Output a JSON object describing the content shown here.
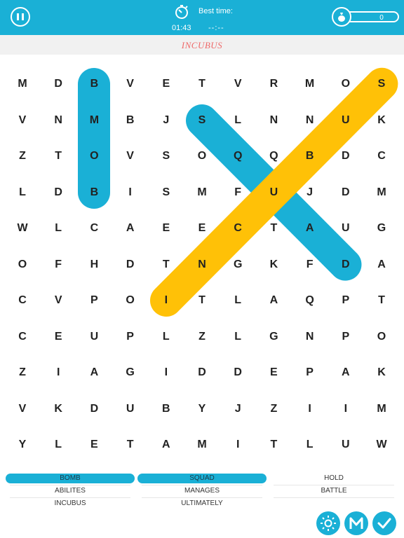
{
  "header": {
    "best_time_label": "Best time:",
    "elapsed": "01:43",
    "best_time": "--:--",
    "coins": "0"
  },
  "current_word": "INCUBUS",
  "grid": [
    [
      "M",
      "D",
      "B",
      "V",
      "E",
      "T",
      "V",
      "R",
      "M",
      "O",
      "S"
    ],
    [
      "V",
      "N",
      "M",
      "B",
      "J",
      "S",
      "L",
      "N",
      "N",
      "U",
      "K"
    ],
    [
      "Z",
      "T",
      "O",
      "V",
      "S",
      "O",
      "Q",
      "Q",
      "B",
      "D",
      "C"
    ],
    [
      "L",
      "D",
      "B",
      "I",
      "S",
      "M",
      "F",
      "U",
      "J",
      "D",
      "M"
    ],
    [
      "W",
      "L",
      "C",
      "A",
      "E",
      "E",
      "C",
      "T",
      "A",
      "U",
      "G"
    ],
    [
      "O",
      "F",
      "H",
      "D",
      "T",
      "N",
      "G",
      "K",
      "F",
      "D",
      "A"
    ],
    [
      "C",
      "V",
      "P",
      "O",
      "I",
      "T",
      "L",
      "A",
      "Q",
      "P",
      "T"
    ],
    [
      "C",
      "E",
      "U",
      "P",
      "L",
      "Z",
      "L",
      "G",
      "N",
      "P",
      "O"
    ],
    [
      "Z",
      "I",
      "A",
      "G",
      "I",
      "D",
      "D",
      "E",
      "P",
      "A",
      "K"
    ],
    [
      "V",
      "K",
      "D",
      "U",
      "B",
      "Y",
      "J",
      "Z",
      "I",
      "I",
      "M"
    ],
    [
      "Y",
      "L",
      "E",
      "T",
      "A",
      "M",
      "I",
      "T",
      "L",
      "U",
      "W"
    ]
  ],
  "highlights": [
    {
      "word": "BOMB",
      "color": "#1ab0d6",
      "from": [
        0,
        2
      ],
      "to": [
        3,
        2
      ]
    },
    {
      "word": "SQUAD",
      "color": "#1ab0d6",
      "from": [
        1,
        5
      ],
      "to": [
        5,
        9
      ]
    },
    {
      "word": "INCUBUS",
      "color": "#ffc107",
      "from": [
        6,
        4
      ],
      "to": [
        0,
        10
      ]
    }
  ],
  "words": [
    {
      "label": "BOMB",
      "found": true
    },
    {
      "label": "SQUAD",
      "found": true
    },
    {
      "label": "HOLD",
      "found": false
    },
    {
      "label": "ABILITES",
      "found": false
    },
    {
      "label": "MANAGES",
      "found": false
    },
    {
      "label": "BATTLE",
      "found": false
    },
    {
      "label": "INCUBUS",
      "found": false
    },
    {
      "label": "ULTIMATELY",
      "found": false
    }
  ],
  "actions": [
    {
      "icon": "sun-icon",
      "label": "hint"
    },
    {
      "icon": "m-letter-icon",
      "label": "M"
    },
    {
      "icon": "checkmark-icon",
      "label": "done"
    }
  ]
}
